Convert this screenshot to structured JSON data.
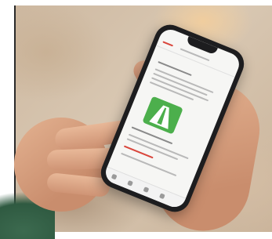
{
  "photo": {
    "alt": "",
    "colors": {
      "background": "#d3bea6",
      "phone": "#1d1d1f",
      "screen": "#f6f6f4",
      "card": "#4caf4c",
      "accent": "#d9463c",
      "skin": "#d99c7b",
      "sleeve": "#2f5a41"
    },
    "icons": {
      "card": "highway-icon",
      "phone": "smartphone-icon"
    }
  }
}
